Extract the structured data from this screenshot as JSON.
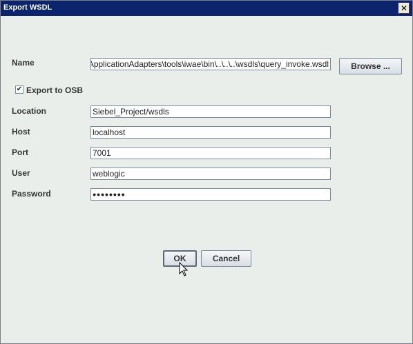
{
  "window": {
    "title": "Export WSDL",
    "close_glyph": "✕"
  },
  "form": {
    "name_label": "Name",
    "name_value": "C:\\oracle\\Middleware\\Oracle_OSB\\ApplicationAdapters\\tools\\iwae\\bin\\..\\..\\..\\wsdls\\query_invoke.wsdl",
    "browse_label": "Browse ...",
    "export_osb_label": "Export to OSB",
    "export_osb_checked": true,
    "check_glyph": "✔",
    "location_label": "Location",
    "location_value": "Siebel_Project/wsdls",
    "host_label": "Host",
    "host_value": "localhost",
    "port_label": "Port",
    "port_value": "7001",
    "user_label": "User",
    "user_value": "weblogic",
    "password_label": "Password",
    "password_value": "●●●●●●●●"
  },
  "actions": {
    "ok_label": "OK",
    "cancel_label": "Cancel"
  },
  "colors": {
    "titlebar": "#0b246b",
    "dialog_bg": "#e9eeea"
  }
}
